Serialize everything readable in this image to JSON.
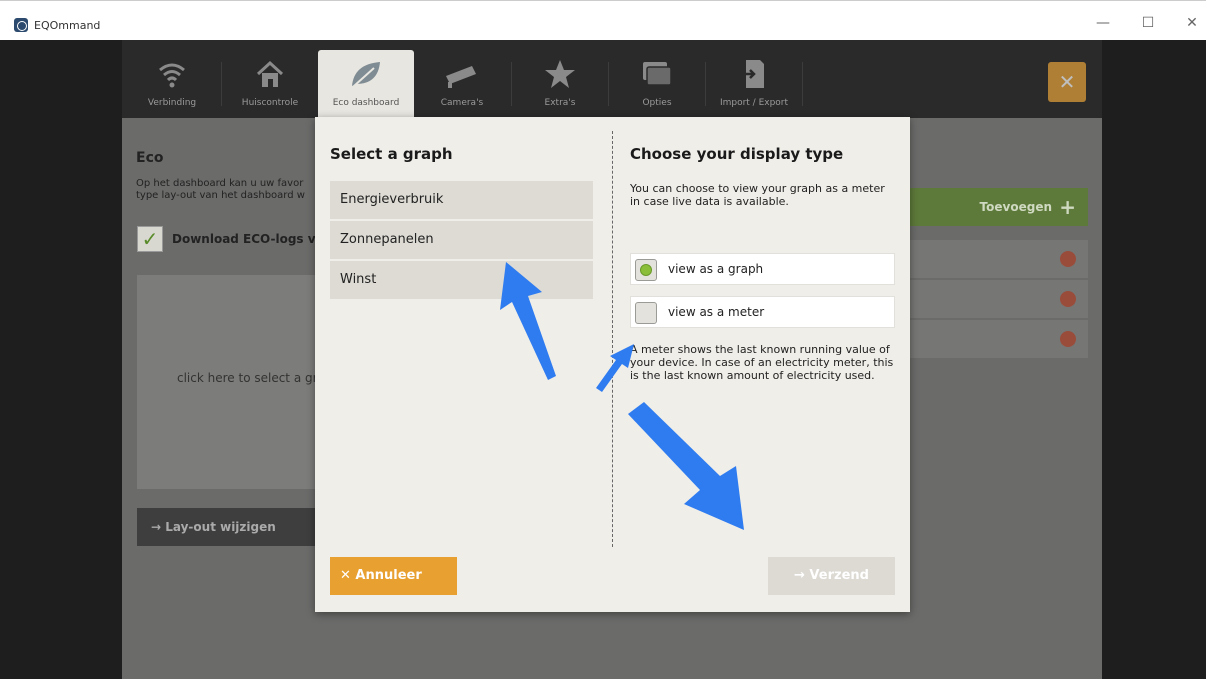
{
  "window": {
    "title": "EQOmmand",
    "minimize": "—",
    "maximize": "☐",
    "close": "✕"
  },
  "nav": {
    "items": [
      {
        "label": "Verbinding",
        "icon": "wifi-icon"
      },
      {
        "label": "Huiscontrole",
        "icon": "home-icon"
      },
      {
        "label": "Eco dashboard",
        "icon": "leaf-icon"
      },
      {
        "label": "Camera's",
        "icon": "camera-icon"
      },
      {
        "label": "Extra's",
        "icon": "star-icon"
      },
      {
        "label": "Opties",
        "icon": "windows-icon"
      },
      {
        "label": "Import / Export",
        "icon": "import-icon"
      }
    ],
    "close": "✕"
  },
  "background": {
    "title": "Eco",
    "description": "Op het dashboard kan u uw favor type lay-out van het dashboard w",
    "check_mark": "✓",
    "download_label": "Download ECO-logs vo",
    "graph_hint": "click here to select a gr",
    "layout_button": "→  Lay-out wijzigen",
    "add_button": "Toevoegen",
    "add_plus": "+"
  },
  "dialog": {
    "left_title": "Select a graph",
    "graphs": [
      "Energieverbruik",
      "Zonnepanelen",
      "Winst"
    ],
    "right_title": "Choose your display type",
    "description": "You can choose to view your graph as a meter in case live data is available.",
    "option_graph": "view as a graph",
    "option_meter": "view as a meter",
    "selected": "view as a graph",
    "meter_note": "A meter shows the last known running value of your device.  In case of an electricity meter, this is the last known amount of electricity used.",
    "cancel": "✕  Annuleer",
    "send": "→  Verzend"
  },
  "colors": {
    "accent_orange": "#e8a030",
    "green": "#8bbf3a",
    "arrow_blue": "#2f7cf0"
  }
}
